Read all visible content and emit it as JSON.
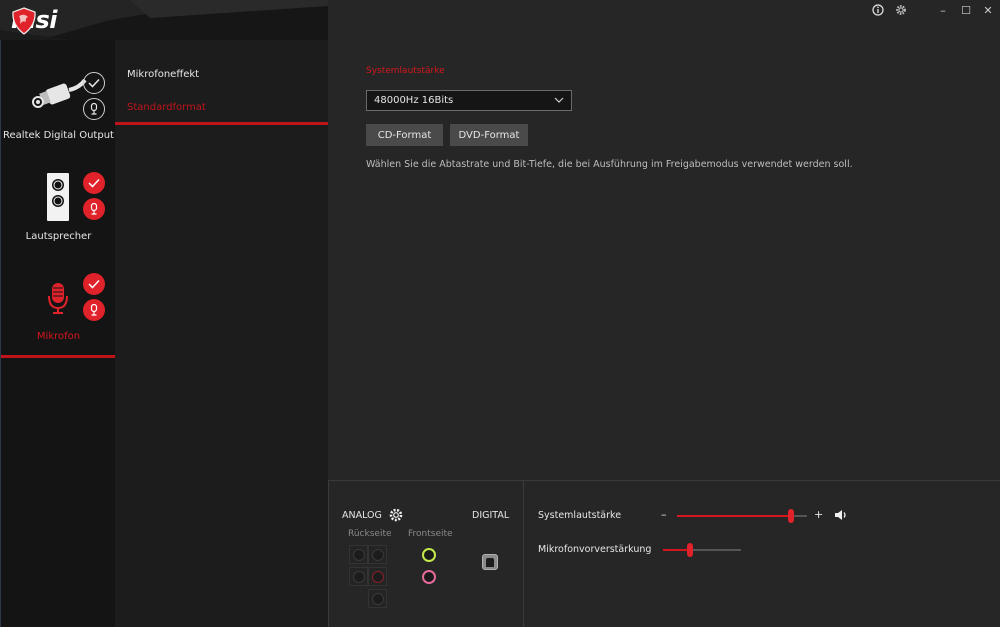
{
  "app": {
    "brand": "msi"
  },
  "window_controls": {
    "info": "info-icon",
    "settings": "gear-icon",
    "minimize": "–",
    "maximize": "☐",
    "close": "✕"
  },
  "devices": [
    {
      "label": "Realtek Digital Output",
      "icon": "optical-cable-icon",
      "default_set": false,
      "comm_set": false,
      "active": false
    },
    {
      "label": "Lautsprecher",
      "icon": "speaker-icon",
      "default_set": true,
      "comm_set": true,
      "active": false
    },
    {
      "label": "Mikrofon",
      "icon": "microphone-icon",
      "default_set": true,
      "comm_set": true,
      "active": true
    }
  ],
  "submenu": {
    "items": [
      {
        "label": "Mikrofoneffekt",
        "active": false
      },
      {
        "label": "Standardformat",
        "active": true
      }
    ]
  },
  "main": {
    "section_title": "Systemlautstärke",
    "format_select": {
      "value": "48000Hz 16Bits"
    },
    "buttons": {
      "cd": "CD-Format",
      "dvd": "DVD-Format"
    },
    "description": "Wählen Sie die Abtastrate und Bit-Tiefe, die bei Ausführung im Freigabemodus verwendet werden soll."
  },
  "bottom": {
    "analog_label": "ANALOG",
    "digital_label": "DIGITAL",
    "rear_label": "Rückseite",
    "front_label": "Frontseite",
    "colors": {
      "front_green": "#c4ea4a",
      "front_pink": "#e86a9a",
      "rear_red": "#8a2029"
    },
    "system_volume": {
      "label": "Systemlautstärke",
      "minus": "–",
      "plus": "+",
      "value_percent": 88
    },
    "mic_boost": {
      "label": "Mikrofonvorverstärkung",
      "value_percent": 35
    }
  },
  "accent_color": "#d4171e"
}
